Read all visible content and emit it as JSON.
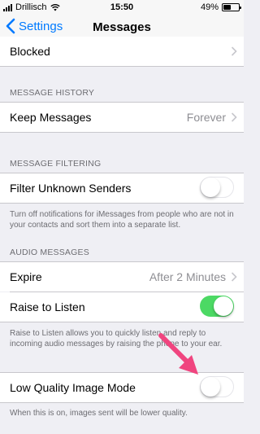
{
  "status_bar": {
    "carrier": "Drillisch",
    "time": "15:50",
    "battery": "49%",
    "battery_level": 0.49
  },
  "nav": {
    "back_label": "Settings",
    "title": "Messages"
  },
  "rows": {
    "blocked": "Blocked",
    "keep_messages": {
      "label": "Keep Messages",
      "value": "Forever"
    },
    "filter_unknown": {
      "label": "Filter Unknown Senders",
      "on": false
    },
    "expire": {
      "label": "Expire",
      "value": "After 2 Minutes"
    },
    "raise_to_listen": {
      "label": "Raise to Listen",
      "on": true
    },
    "low_quality": {
      "label": "Low Quality Image Mode",
      "on": false
    }
  },
  "sections": {
    "message_history": "MESSAGE HISTORY",
    "message_filtering": "MESSAGE FILTERING",
    "audio_messages": "AUDIO MESSAGES"
  },
  "footers": {
    "filtering": "Turn off notifications for iMessages from people who are not in your contacts and sort them into a separate list.",
    "raise": "Raise to Listen allows you to quickly listen and reply to incoming audio messages by raising the phone to your ear.",
    "low_quality": "When this is on, images sent will be lower quality."
  },
  "colors": {
    "accent": "#007aff",
    "toggle_on": "#4cd964",
    "annotation_arrow": "#f0457f"
  },
  "icons": {
    "back": "chevron-left-icon",
    "disclosure": "chevron-right-icon",
    "signal": "signal-icon",
    "wifi": "wifi-icon",
    "battery": "battery-icon",
    "annotation": "arrow-icon"
  }
}
